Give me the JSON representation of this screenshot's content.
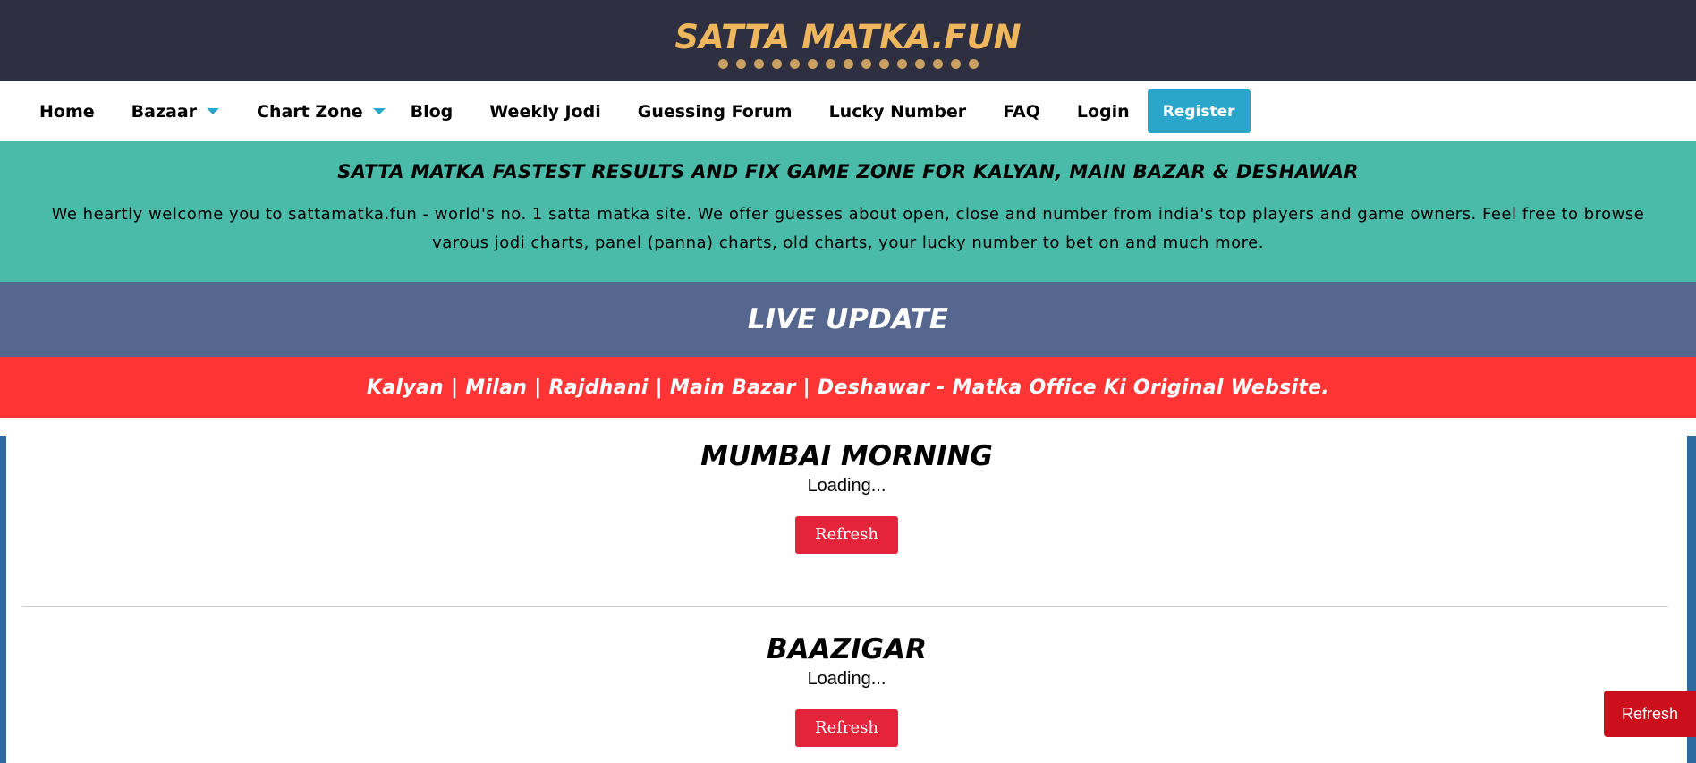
{
  "header": {
    "logo_text": "SATTA MATKA.FUN",
    "logo_color": "#eeb65d",
    "background": "#2e2f40"
  },
  "nav": {
    "items": [
      {
        "label": "Home"
      },
      {
        "label": "Bazaar",
        "dropdown": true
      },
      {
        "label": "Chart Zone",
        "dropdown": true
      },
      {
        "label": "Blog"
      },
      {
        "label": "Weekly Jodi"
      },
      {
        "label": "Guessing Forum"
      },
      {
        "label": "Lucky Number"
      },
      {
        "label": "FAQ"
      },
      {
        "label": "Login"
      }
    ],
    "register_label": "Register",
    "accent": "#2ba6cb"
  },
  "intro": {
    "heading": "SATTA MATKA FASTEST RESULTS AND FIX GAME ZONE FOR KALYAN, MAIN BAZAR & DESHAWAR",
    "text": "We heartly welcome you to sattamatka.fun - world's no. 1 satta matka site. We offer guesses about open, close and number from india's top players and game owners. Feel free to browse varous jodi charts, panel (panna) charts, old charts, your lucky number to bet on and much more.",
    "background": "#4abaa9"
  },
  "live_update": {
    "title": "LIVE UPDATE",
    "background": "#55668f"
  },
  "banner": {
    "text": "Kalyan | Milan | Rajdhani | Main Bazar | Deshawar - Matka Office Ki Original Website.",
    "background": "#ff3434"
  },
  "results": [
    {
      "name": "MUMBAI MORNING",
      "status": "Loading...",
      "button": "Refresh"
    },
    {
      "name": "BAAZIGAR",
      "status": "Loading...",
      "button": "Refresh"
    }
  ],
  "floating_refresh": {
    "label": "Refresh",
    "color": "#cc0f1c"
  }
}
